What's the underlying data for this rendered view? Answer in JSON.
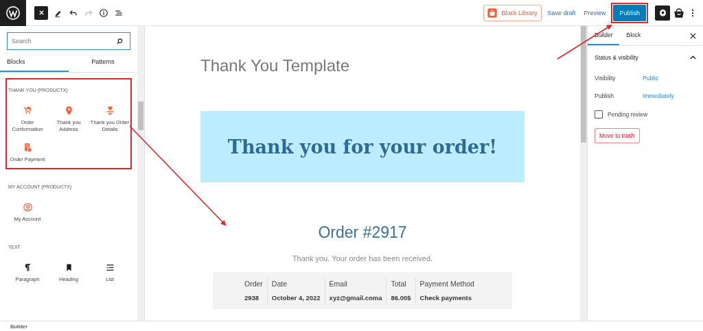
{
  "toolbar": {
    "block_library": "Block Library",
    "save_draft": "Save draft",
    "preview": "Preview",
    "publish": "Publish",
    "publish_highlighted": true
  },
  "inserter": {
    "search": {
      "placeholder": "Search"
    },
    "tabs": [
      {
        "label": "Blocks",
        "selected": true
      },
      {
        "label": "Patterns",
        "selected": false
      }
    ],
    "sections": [
      {
        "title": "THANK YOU (PRODUCTX)",
        "highlighted": true,
        "blocks": [
          {
            "label": "Order Conformation"
          },
          {
            "label": "Thank you Address"
          },
          {
            "label": "Thank you Order Details"
          },
          {
            "label": "Order Payment"
          }
        ]
      },
      {
        "title": "MY ACCOUNT (PRODUCTX)",
        "highlighted": false,
        "blocks": [
          {
            "label": "My Account"
          }
        ]
      },
      {
        "title": "TEXT",
        "highlighted": false,
        "blocks": [
          {
            "label": "Paragraph"
          },
          {
            "label": "Heading"
          },
          {
            "label": "List"
          }
        ]
      }
    ]
  },
  "canvas": {
    "title": "Thank You Template",
    "banner": "Thank you for your order!",
    "order_heading": "Order #2917",
    "message": "Thank you. Your order has been received.",
    "order_table": [
      {
        "header": "Order",
        "value": "2938"
      },
      {
        "header": "Date",
        "value": "October 4, 2022"
      },
      {
        "header": "Email",
        "value": "xyz@gmail.coma"
      },
      {
        "header": "Total",
        "value": "86.00$"
      },
      {
        "header": "Payment Method",
        "value": "Check payments"
      }
    ]
  },
  "settings": {
    "tabs": [
      {
        "label": "Builder",
        "selected": true
      },
      {
        "label": "Block",
        "selected": false
      }
    ],
    "panel": {
      "title": "Status & visibility",
      "expanded": true,
      "rows": [
        {
          "label": "Visibility",
          "value": "Public"
        },
        {
          "label": "Publish",
          "value": "Immediately"
        }
      ],
      "pending_review": {
        "label": "Pending review",
        "checked": false
      },
      "trash": "Move to trash"
    }
  },
  "footer": {
    "label": "Builder"
  }
}
